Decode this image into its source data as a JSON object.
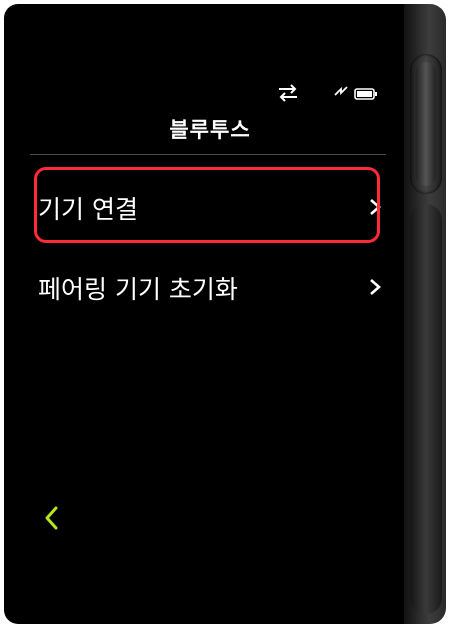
{
  "screen": {
    "title": "블루투스",
    "menu": [
      {
        "label": "기기 연결",
        "highlighted": true
      },
      {
        "label": "페어링 기기 초기화",
        "highlighted": false
      }
    ]
  },
  "status": {
    "icons": [
      "sync-icon",
      "signal-icon",
      "battery-icon"
    ]
  },
  "colors": {
    "background": "#000000",
    "text": "#ffffff",
    "highlight_border": "#ff2a3a",
    "back_accent": "#b5e61d"
  }
}
